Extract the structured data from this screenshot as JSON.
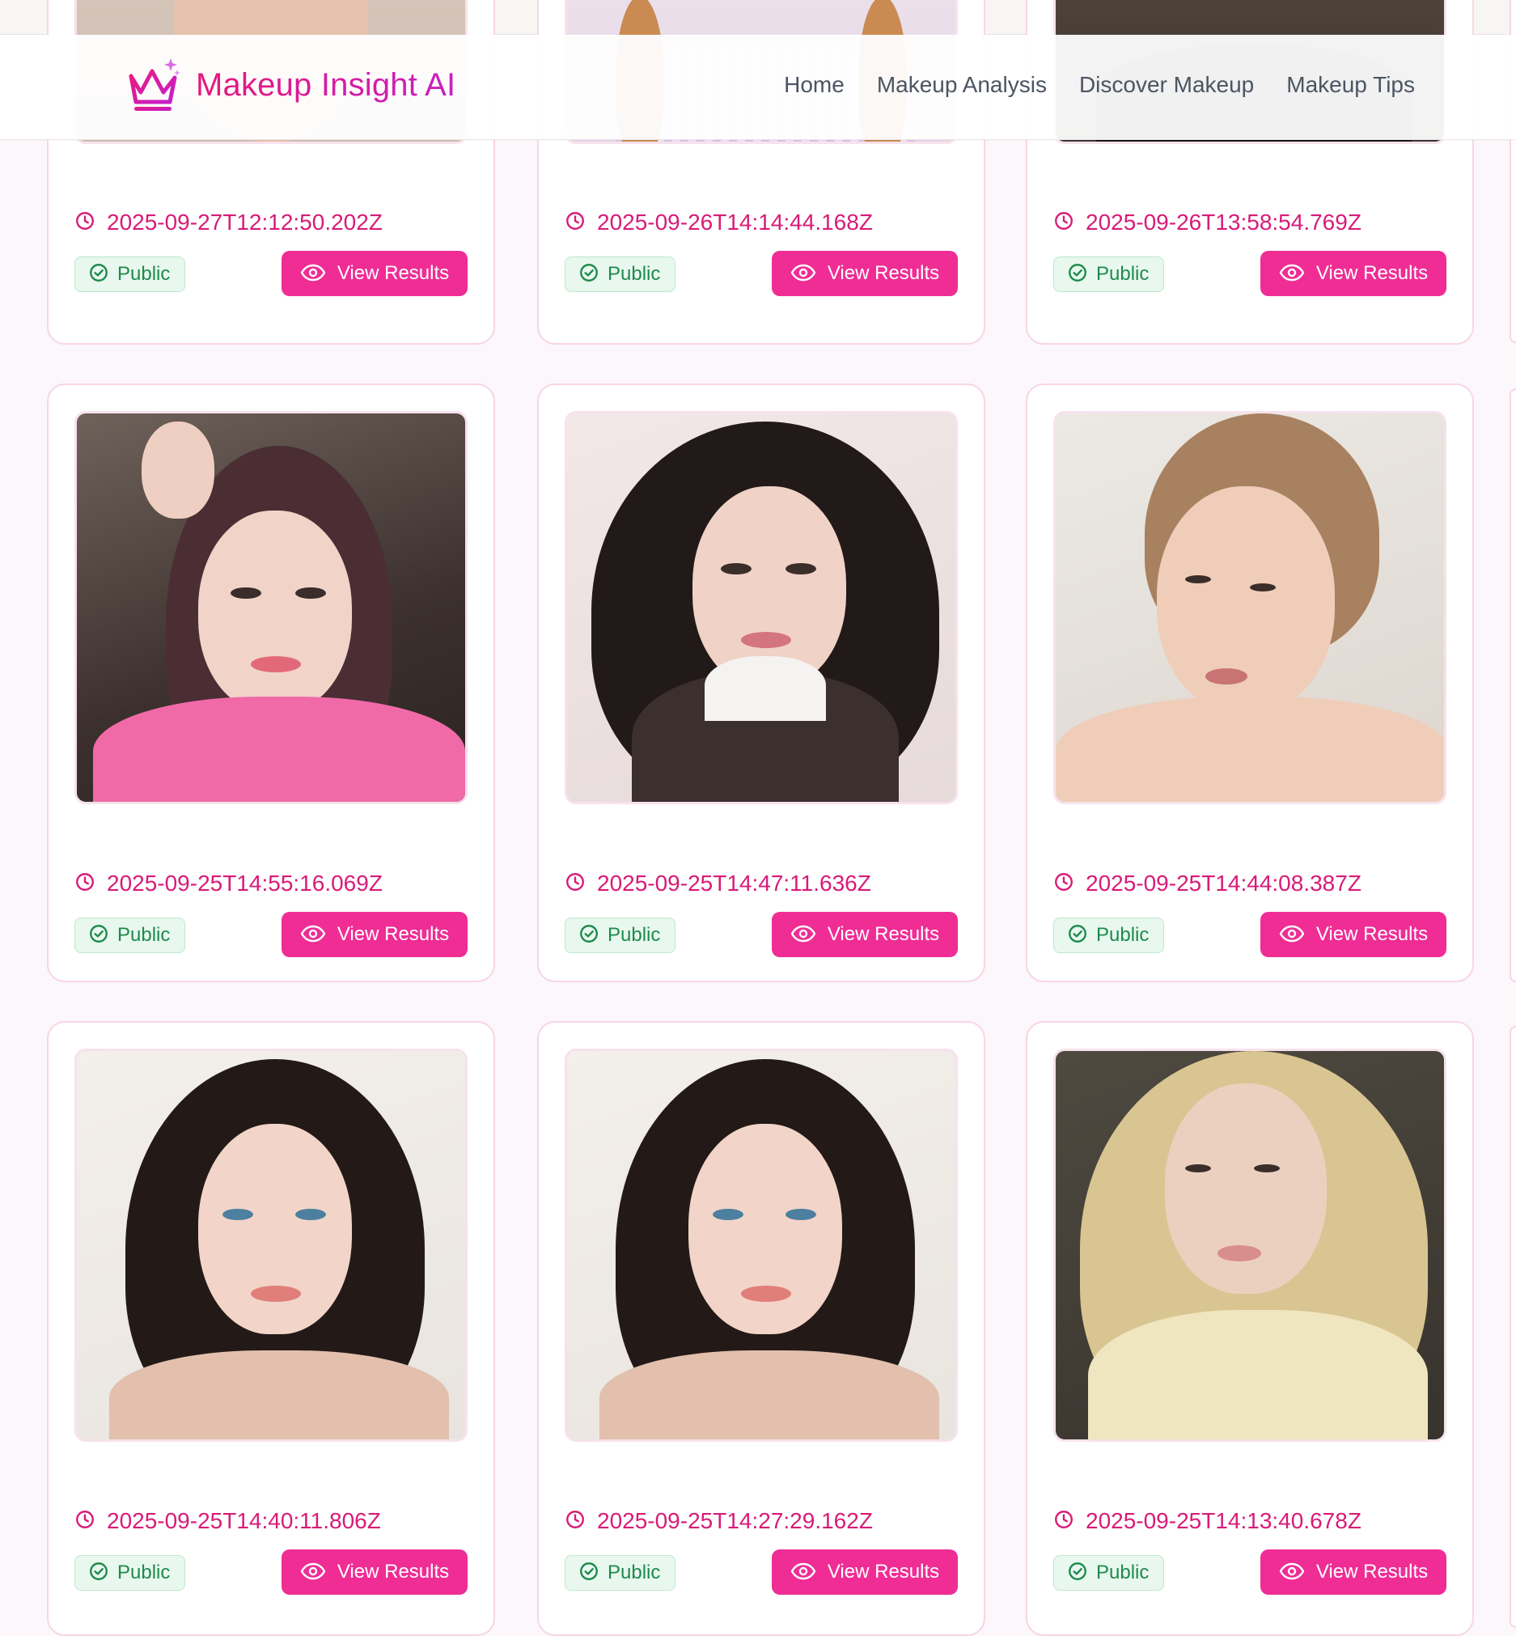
{
  "header": {
    "brand": "Makeup Insight AI",
    "nav": [
      "Home",
      "Makeup Analysis",
      "Discover Makeup",
      "Makeup Tips"
    ]
  },
  "cards": [
    {
      "timestamp": "2025-09-27T12:12:50.202Z",
      "visibility": "Public",
      "action": "View Results"
    },
    {
      "timestamp": "2025-09-26T14:14:44.168Z",
      "visibility": "Public",
      "action": "View Results"
    },
    {
      "timestamp": "2025-09-26T13:58:54.769Z",
      "visibility": "Public",
      "action": "View Results"
    },
    {
      "timestamp": "2025-09-25T14:55:16.069Z",
      "visibility": "Public",
      "action": "View Results"
    },
    {
      "timestamp": "2025-09-25T14:47:11.636Z",
      "visibility": "Public",
      "action": "View Results"
    },
    {
      "timestamp": "2025-09-25T14:44:08.387Z",
      "visibility": "Public",
      "action": "View Results"
    },
    {
      "timestamp": "2025-09-25T14:40:11.806Z",
      "visibility": "Public",
      "action": "View Results"
    },
    {
      "timestamp": "2025-09-25T14:27:29.162Z",
      "visibility": "Public",
      "action": "View Results"
    },
    {
      "timestamp": "2025-09-25T14:13:40.678Z",
      "visibility": "Public",
      "action": "View Results"
    }
  ],
  "colors": {
    "accent": "#ef2d95",
    "timestamp": "#d81b78",
    "public_bg": "#e8f8ee",
    "public_text": "#1e8a4c",
    "nav_text": "#4b5563",
    "card_border": "#f8d5e6"
  },
  "icons": {
    "logo": "crown-icon",
    "time": "clock-icon",
    "public": "check-circle-icon",
    "view": "eye-icon"
  }
}
